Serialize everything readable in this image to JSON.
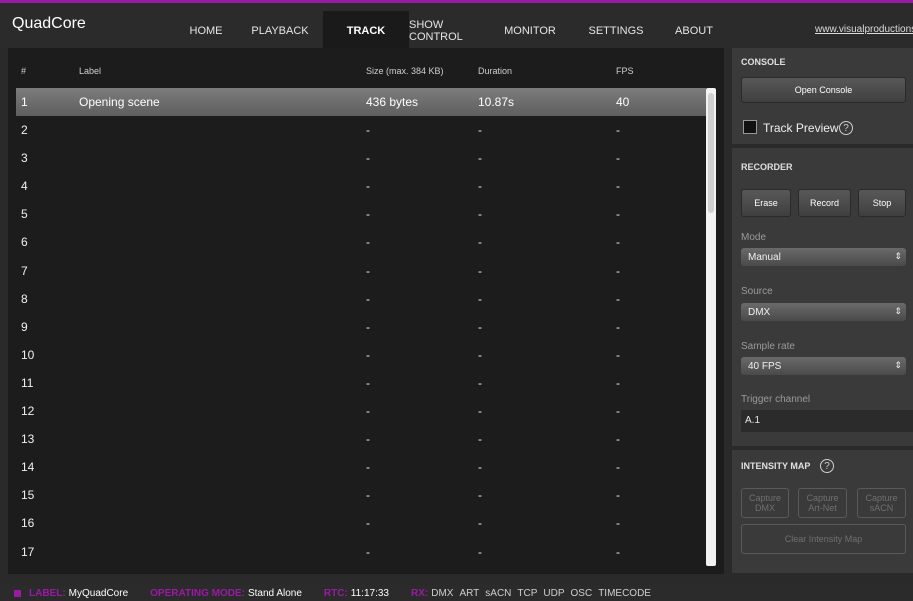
{
  "app": {
    "title": "QuadCore",
    "website": "www.visualproductions.nl"
  },
  "nav": [
    {
      "label": "HOME",
      "active": false
    },
    {
      "label": "PLAYBACK",
      "active": false
    },
    {
      "label": "TRACK",
      "active": true
    },
    {
      "label": "SHOW CONTROL",
      "active": false
    },
    {
      "label": "MONITOR",
      "active": false
    },
    {
      "label": "SETTINGS",
      "active": false
    },
    {
      "label": "ABOUT",
      "active": false
    }
  ],
  "table": {
    "headers": {
      "num": "#",
      "label": "Label",
      "size": "Size (max. 384 KB)",
      "duration": "Duration",
      "fps": "FPS"
    },
    "rows": [
      {
        "num": "1",
        "label": "Opening scene",
        "size": "436 bytes",
        "duration": "10.87s",
        "fps": "40",
        "selected": true
      },
      {
        "num": "2",
        "label": "",
        "size": "-",
        "duration": "-",
        "fps": "-"
      },
      {
        "num": "3",
        "label": "",
        "size": "-",
        "duration": "-",
        "fps": "-"
      },
      {
        "num": "4",
        "label": "",
        "size": "-",
        "duration": "-",
        "fps": "-"
      },
      {
        "num": "5",
        "label": "",
        "size": "-",
        "duration": "-",
        "fps": "-"
      },
      {
        "num": "6",
        "label": "",
        "size": "-",
        "duration": "-",
        "fps": "-"
      },
      {
        "num": "7",
        "label": "",
        "size": "-",
        "duration": "-",
        "fps": "-"
      },
      {
        "num": "8",
        "label": "",
        "size": "-",
        "duration": "-",
        "fps": "-"
      },
      {
        "num": "9",
        "label": "",
        "size": "-",
        "duration": "-",
        "fps": "-"
      },
      {
        "num": "10",
        "label": "",
        "size": "-",
        "duration": "-",
        "fps": "-"
      },
      {
        "num": "11",
        "label": "",
        "size": "-",
        "duration": "-",
        "fps": "-"
      },
      {
        "num": "12",
        "label": "",
        "size": "-",
        "duration": "-",
        "fps": "-"
      },
      {
        "num": "13",
        "label": "",
        "size": "-",
        "duration": "-",
        "fps": "-"
      },
      {
        "num": "14",
        "label": "",
        "size": "-",
        "duration": "-",
        "fps": "-"
      },
      {
        "num": "15",
        "label": "",
        "size": "-",
        "duration": "-",
        "fps": "-"
      },
      {
        "num": "16",
        "label": "",
        "size": "-",
        "duration": "-",
        "fps": "-"
      },
      {
        "num": "17",
        "label": "",
        "size": "-",
        "duration": "-",
        "fps": "-"
      }
    ]
  },
  "console": {
    "title": "CONSOLE",
    "open_button": "Open Console",
    "track_preview_label": "Track Preview",
    "track_preview_checked": false,
    "help_glyph": "?"
  },
  "recorder": {
    "title": "RECORDER",
    "erase": "Erase",
    "record": "Record",
    "stop": "Stop",
    "mode_label": "Mode",
    "mode_value": "Manual",
    "source_label": "Source",
    "source_value": "DMX",
    "rate_label": "Sample rate",
    "rate_value": "40 FPS",
    "trigger_label": "Trigger channel",
    "trigger_value": "A.1"
  },
  "intensity": {
    "title": "INTENSITY MAP",
    "help_glyph": "?",
    "cap_dmx_1": "Capture",
    "cap_dmx_2": "DMX",
    "cap_artnet_1": "Capture",
    "cap_artnet_2": "Art-Net",
    "cap_sacn_1": "Capture",
    "cap_sacn_2": "sACN",
    "clear": "Clear Intensity Map"
  },
  "footer": {
    "label_key": "LABEL:",
    "label_val": "MyQuadCore",
    "mode_key": "OPERATING MODE:",
    "mode_val": "Stand Alone",
    "rtc_key": "RTC:",
    "rtc_val": "11:17:33",
    "rx_key": "RX:",
    "rx_items": [
      "DMX",
      "ART",
      "sACN",
      "TCP",
      "UDP",
      "OSC",
      "TIMECODE"
    ]
  },
  "colors": {
    "accent": "#9a1aa5",
    "background": "#2a2a2a",
    "table_bg": "#1c1c1c",
    "selected_row": "#6c6c6c"
  }
}
